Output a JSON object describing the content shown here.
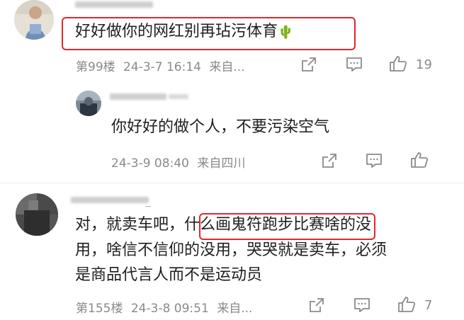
{
  "comment1": {
    "text": "好好做你的网红别再玷污体育",
    "emoji": "🌵",
    "floor": "第99楼",
    "datetime": "24-3-7 16:14",
    "location": "来自...",
    "likes": "19"
  },
  "reply1": {
    "text": "你好好的做个人，不要污染空气",
    "datetime": "24-3-9 08:40",
    "location": "来自四川"
  },
  "comment2": {
    "text_line1_a": "对，就卖车吧，",
    "text_line1_highlight": "什么画鬼符跑步比赛啥",
    "text_line1_b": "的没",
    "text_line2": "用，啥信不信仰的没用，哭哭就是卖车，必须",
    "text_line3": "是商品代言人而不是运动员",
    "floor": "第155楼",
    "datetime": "24-3-8 09:51",
    "location": "来自...",
    "likes": "7"
  },
  "colors": {
    "highlight_border": "#e3262b",
    "meta_text": "#8a8a8a",
    "main_text": "#1e1e1e"
  },
  "icons": [
    "share-icon",
    "comment-icon",
    "like-icon"
  ]
}
